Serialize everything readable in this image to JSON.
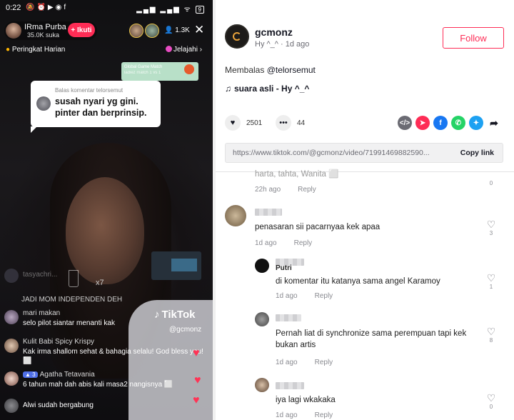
{
  "live": {
    "status": {
      "time": "0:22",
      "battery": "9"
    },
    "host": {
      "name": "IRma Purba",
      "likes": "35.0K suka"
    },
    "follow_label": "+ Ikuti",
    "viewer_count": "1.3K",
    "ranking_label": "Peringkat Harian",
    "explore_label": "Jelajahi",
    "promo": {
      "title": "Global Game Match",
      "sub": "ladiez match 1 vs 1"
    },
    "reply_card": {
      "header": "Balas komentar telorsemut",
      "text": "susah nyari yg gini. pinter dan berprinsip."
    },
    "faded_user": "tasyachri...",
    "x_count": "x7",
    "banner": "JADI MOM INDEPENDEN DEH",
    "watermark": {
      "brand": "TikTok",
      "user": "@gcmonz"
    },
    "chat": [
      {
        "name": "mari makan",
        "message": "selo pilot siantar menanti kak"
      },
      {
        "name": "Kulit Babi Spicy Krispy",
        "message": "Kak irma shallom sehat & bahagia selalu! God bless you! ⬜"
      },
      {
        "level": "3",
        "name": "Agatha Tetavania",
        "message": "6 tahun mah dah abis kali masa2 nangisnya ⬜"
      },
      {
        "name": "Alwi sudah bergabung",
        "message": ""
      }
    ],
    "colors": {
      "accent": "#fe2c55"
    }
  },
  "panel": {
    "username": "gcmonz",
    "subtitle": "Hy ^_^ · 1d ago",
    "follow_label": "Follow",
    "reply_prefix": "Membalas ",
    "reply_user": "@telorsemut",
    "sound": "suara asli - Hy ^_^",
    "likes": "2501",
    "comments": "44",
    "share_icons": [
      "embed-icon",
      "send-icon",
      "facebook-icon",
      "whatsapp-icon",
      "twitter-icon",
      "forward-icon"
    ],
    "link": {
      "url": "https://www.tiktok.com/@gcmonz/video/71991469882590...",
      "copy_label": "Copy link"
    },
    "comment_list": [
      {
        "text": "harta, tahta, Wanita ⬜",
        "time": "22h ago",
        "reply": "Reply",
        "likes": "0"
      },
      {
        "text": "penasaran sii pacarnyaa kek apaa",
        "time": "1d ago",
        "reply": "Reply",
        "likes": "3"
      },
      {
        "name": "Putri",
        "text": "di komentar itu katanya sama angel Karamoy",
        "time": "1d ago",
        "reply": "Reply",
        "likes": "1"
      },
      {
        "text": "Pernah liat di synchronize sama perempuan tapi kek bukan artis",
        "time": "1d ago",
        "reply": "Reply",
        "likes": "8"
      },
      {
        "text": "iya lagi wkakaka",
        "time": "1d ago",
        "reply": "Reply",
        "likes": "0"
      }
    ],
    "colors": {
      "accent": "#fe2c55",
      "facebook": "#1877f2",
      "whatsapp": "#25d366",
      "twitter": "#1da1f2"
    }
  }
}
